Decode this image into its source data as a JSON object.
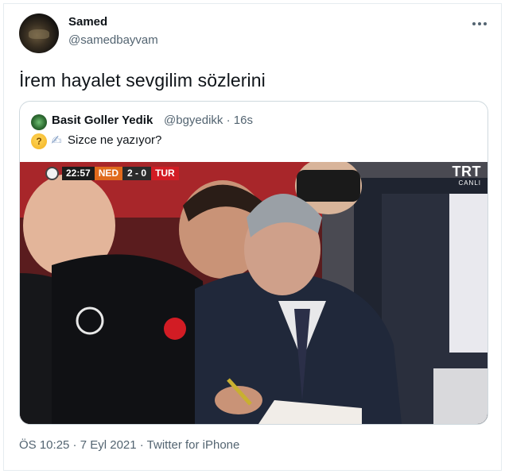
{
  "tweet": {
    "author": {
      "display_name": "Samed",
      "handle": "@samedbayvam"
    },
    "text": "İrem hayalet sevgilim sözlerini",
    "more_icon": "more-horizontal-icon",
    "meta": "ÖS 10:25 · 7 Eyl 2021 · Twitter for iPhone"
  },
  "quoted_tweet": {
    "author": {
      "display_name": "Basit Goller Yedik",
      "handle_time": "@bgyedikk · 16s"
    },
    "emojis": [
      "thinking-face-icon",
      "writing-hand-icon"
    ],
    "text": "Sizce ne yazıyor?",
    "media": {
      "scorebug": {
        "time": "22:57",
        "home": "NED",
        "score": "2 - 0",
        "away": "TUR"
      },
      "broadcaster": {
        "logo": "TRT",
        "sub": "CANLI"
      }
    }
  },
  "colors": {
    "text_primary": "#0f1419",
    "text_secondary": "#536471",
    "border": "#cfd9de",
    "scorebug_home": "#e06a1c",
    "scorebug_away": "#d21c24"
  }
}
